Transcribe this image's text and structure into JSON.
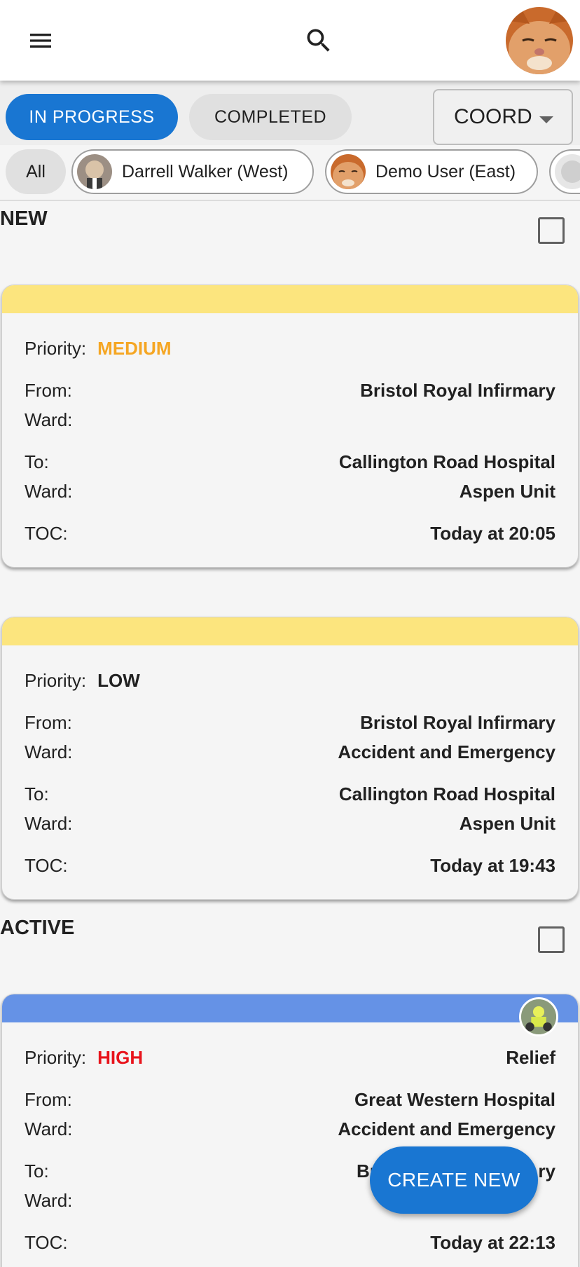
{
  "header": {
    "menu_icon": "menu-icon",
    "search_icon": "search-icon",
    "profile_avatar": "orange-cat-photo"
  },
  "filters": {
    "tabs": [
      {
        "label": "IN PROGRESS",
        "active": true
      },
      {
        "label": "COMPLETED",
        "active": false
      }
    ],
    "role_select": {
      "value": "COORD"
    }
  },
  "chips": {
    "all_label": "All",
    "users": [
      {
        "label": "Darrell Walker (West)"
      },
      {
        "label": "Demo User (East)"
      },
      {
        "label": ""
      }
    ]
  },
  "labels": {
    "priority": "Priority:",
    "from": "From:",
    "ward": "Ward:",
    "to": "To:",
    "toc": "TOC:"
  },
  "sections": [
    {
      "title": "NEW",
      "cards": [
        {
          "bar_color": "#fce57e",
          "priority": "MEDIUM",
          "priority_color": "#f5a623",
          "from": "Bristol Royal Infirmary",
          "from_ward": "",
          "to": "Callington Road Hospital",
          "to_ward": "Aspen Unit",
          "toc": "Today at 20:05"
        },
        {
          "bar_color": "#fce57e",
          "priority": "LOW",
          "priority_color": "#212121",
          "from": "Bristol Royal Infirmary",
          "from_ward": "Accident and Emergency",
          "to": "Callington Road Hospital",
          "to_ward": "Aspen Unit",
          "toc": "Today at 19:43"
        }
      ]
    },
    {
      "title": "ACTIVE",
      "cards": [
        {
          "bar_color": "#6592e6",
          "priority": "HIGH",
          "priority_color": "#e8141c",
          "tag": "Relief",
          "from": "Great Western Hospital",
          "from_ward": "Accident and Emergency",
          "to": "Br",
          "to_tail": "ry",
          "to_ward": "",
          "toc": "Today at 22:13"
        }
      ]
    }
  ],
  "fab": {
    "label": "CREATE NEW"
  }
}
